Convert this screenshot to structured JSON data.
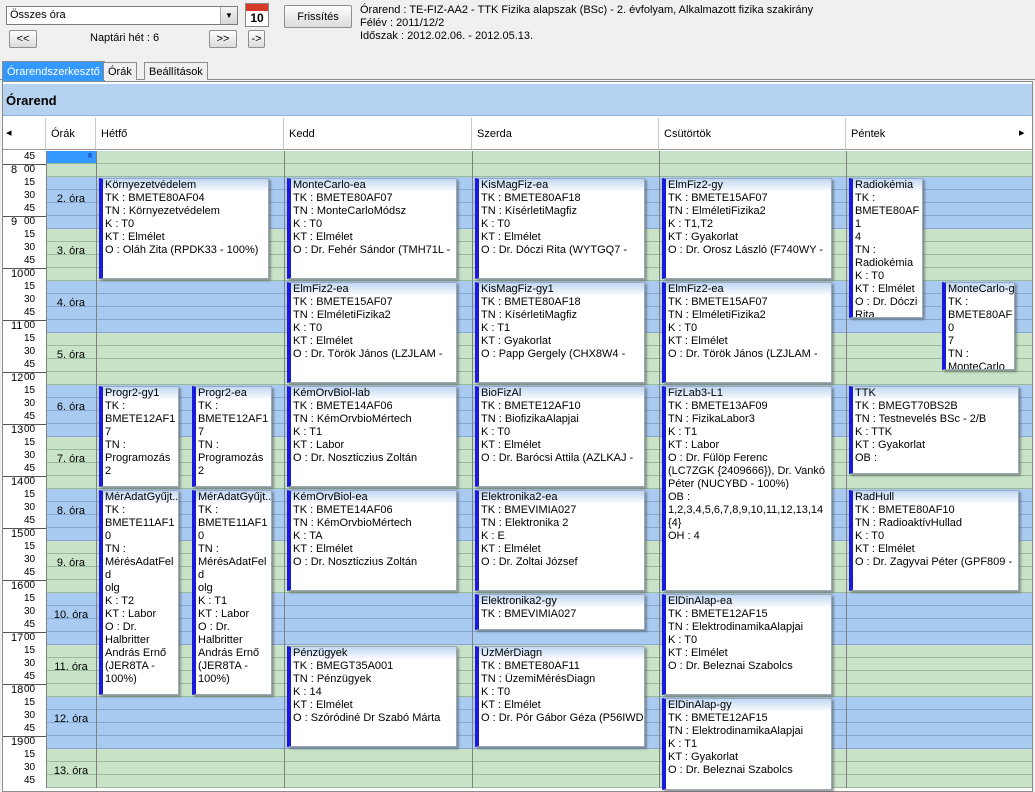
{
  "toolbar": {
    "select_value": "Összes óra",
    "refresh_label": "Frissítés",
    "calendar_icon_text": "10",
    "prev_label": "<<",
    "next_label": ">>",
    "end_label": "->",
    "week_label": "Naptári hét : 6"
  },
  "info": {
    "line1": "Órarend : TE-FIZ-AA2 - TTK Fizika alapszak (BSc) - 2. évfolyam, Alkalmazott fizika szakirány",
    "line2": "Félév : 2011/12/2",
    "line3": "Időszak : 2012.02.06. - 2012.05.13."
  },
  "tabs": [
    "Órarendszerkesztő",
    "Órák",
    "Beállítások"
  ],
  "panel_title": "Órarend",
  "columns": {
    "orak": "Órák",
    "days": [
      "Hétfő",
      "Kedd",
      "Szerda",
      "Csütörtök",
      "Péntek"
    ]
  },
  "scroll": {
    "left": "◂",
    "right": "▸",
    "up": "»"
  },
  "time": {
    "hours": [
      "8",
      "9",
      "10",
      "11",
      "12",
      "13",
      "14",
      "15",
      "16",
      "17",
      "18",
      "19"
    ],
    "hour_minute": "00",
    "minutes": [
      "15",
      "30",
      "45"
    ],
    "top_min": "45"
  },
  "lessons": [
    "2. óra",
    "3. óra",
    "4. óra",
    "5. óra",
    "6. óra",
    "7. óra",
    "8. óra",
    "9. óra",
    "10. óra",
    "11. óra",
    "12. óra",
    "13. óra"
  ],
  "events": [
    {
      "title": "Környezetvédelem",
      "lines": [
        "TK : BMETE80AF04",
        "TN : Környezetvédelem",
        "K : T0",
        "KT : Elmélet",
        "O : Oláh Zita (RPDK33 - 100%)"
      ]
    },
    {
      "title": "MonteCarlo-ea",
      "lines": [
        "TK : BMETE80AF07",
        "TN : MonteCarloMódsz",
        "K : T0",
        "KT : Elmélet",
        "O : Dr. Fehér Sándor (TMH71L -"
      ]
    },
    {
      "title": "KisMagFiz-ea",
      "lines": [
        "TK : BMETE80AF18",
        "TN : KísérletiMagfiz",
        "K : T0",
        "KT : Elmélet",
        "O : Dr. Dóczi Rita (WYTGQ7 -"
      ]
    },
    {
      "title": "ElmFiz2-gy",
      "lines": [
        "TK : BMETE15AF07",
        "TN : ElméletiFizika2",
        "K : T1,T2",
        "KT : Gyakorlat",
        "O : Dr. Orosz László (F740WY -"
      ]
    },
    {
      "title": "Radiokémia",
      "lines": [
        "TK :",
        "BMETE80AF1",
        "4",
        "TN :",
        "Radiokémia",
        "K : T0",
        "KT : Elmélet",
        "O : Dr. Dóczi",
        "Rita"
      ]
    },
    {
      "title": "ElmFiz2-ea",
      "lines": [
        "TK : BMETE15AF07",
        "TN : ElméletiFizika2",
        "K : T0",
        "KT : Elmélet",
        "O : Dr. Török János (LZJLAM -"
      ]
    },
    {
      "title": "KisMagFiz-gy1",
      "lines": [
        "TK : BMETE80AF18",
        "TN : KísérletiMagfiz",
        "K : T1",
        "KT : Gyakorlat",
        "O : Papp Gergely (CHX8W4 -"
      ]
    },
    {
      "title": "ElmFiz2-ea",
      "lines": [
        "TK : BMETE15AF07",
        "TN : ElméletiFizika2",
        "K : T0",
        "KT : Elmélet",
        "O : Dr. Török János (LZJLAM -"
      ]
    },
    {
      "title": "MonteCarlo-gy",
      "lines": [
        "TK :",
        "BMETE80AF0",
        "7",
        "TN :",
        "MonteCarloMó"
      ]
    },
    {
      "title": "Progr2-gy1",
      "lines": [
        "TK :",
        "BMETE12AF1",
        "7",
        "TN :",
        "Programozás 2"
      ]
    },
    {
      "title": "Progr2-ea",
      "lines": [
        "TK :",
        "BMETE12AF1",
        "7",
        "TN :",
        "Programozás 2"
      ]
    },
    {
      "title": "KémOrvBiol-lab",
      "lines": [
        "TK : BMETE14AF06",
        "TN : KémOrvbioMértech",
        "K : T1",
        "KT : Labor",
        "O : Dr. Noszticzius Zoltán"
      ]
    },
    {
      "title": "BioFizAl",
      "lines": [
        "TK : BMETE12AF10",
        "TN : BiofizikaAlapjai",
        "K : T0",
        "KT : Elmélet",
        "O : Dr. Barócsi Attila (AZLKAJ -"
      ]
    },
    {
      "title": "FizLab3-L1",
      "lines": [
        "TK : BMETE13AF09",
        "TN : FizikaLabor3",
        "K : T1",
        "KT : Labor",
        "O : Dr. Fülöp Ferenc",
        "(LC7ZGK {2409666}), Dr. Vankó",
        "Péter (NUCYBD - 100%)",
        "OB :",
        "1,2,3,4,5,6,7,8,9,10,11,12,13,14",
        "{4}",
        "OH : 4"
      ]
    },
    {
      "title": "TTK",
      "lines": [
        "TK : BMEGT70BS2B",
        "TN : Testnevelés BSc - 2/B",
        "K : TTK",
        "KT : Gyakorlat",
        "OB :"
      ]
    },
    {
      "title": "MérAdatGyűjt...",
      "lines": [
        "TK :",
        "BMETE11AF1",
        "0",
        "TN :",
        "MérésAdatFeld",
        "olg",
        "K : T2",
        "KT : Labor",
        "O : Dr.",
        "Halbritter",
        "András Ernő",
        "(JER8TA -",
        "100%)"
      ]
    },
    {
      "title": "MérAdatGyűjt...",
      "lines": [
        "TK :",
        "BMETE11AF1",
        "0",
        "TN :",
        "MérésAdatFeld",
        "olg",
        "K : T1",
        "KT : Labor",
        "O : Dr.",
        "Halbritter",
        "András Ernő",
        "(JER8TA -",
        "100%)"
      ]
    },
    {
      "title": "KémOrvBiol-ea",
      "lines": [
        "TK : BMETE14AF06",
        "TN : KémOrvbioMértech",
        "K : TA",
        "KT : Elmélet",
        "O : Dr. Noszticzius Zoltán"
      ]
    },
    {
      "title": "Elektronika2-ea",
      "lines": [
        "TK : BMEVIMIA027",
        "TN : Elektronika 2",
        "K : E",
        "KT : Elmélet",
        "O : Dr. Zoltai József"
      ]
    },
    {
      "title": "RadHull",
      "lines": [
        "TK : BMETE80AF10",
        "TN : RadioaktívHullad",
        "K : T0",
        "KT : Elmélet",
        "O : Dr. Zagyvai Péter (GPF809 -"
      ]
    },
    {
      "title": "Elektronika2-gy",
      "lines": [
        "TK : BMEVIMIA027"
      ]
    },
    {
      "title": "ElDinAlap-ea",
      "lines": [
        "TK : BMETE12AF15",
        "TN : ElektrodinamikaAlapjai",
        "K : T0",
        "KT : Elmélet",
        "O : Dr. Beleznai Szabolcs"
      ]
    },
    {
      "title": "Pénzügyek",
      "lines": [
        "TK : BMEGT35A001",
        "TN : Pénzügyek",
        "K : 14",
        "KT : Elmélet",
        "O : Szóródiné Dr Szabó Márta"
      ]
    },
    {
      "title": "ÜzMérDiagn",
      "lines": [
        "TK : BMETE80AF11",
        "TN : ÜzemiMérésDiagn",
        "K : T0",
        "KT : Elmélet",
        "O : Dr. Pór Gábor Géza (P56IWD"
      ]
    },
    {
      "title": "ElDinAlap-gy",
      "lines": [
        "TK : BMETE12AF15",
        "TN : ElektrodinamikaAlapjai",
        "K : T1",
        "KT : Gyakorlat",
        "O : Dr. Beleznai Szabolcs"
      ]
    }
  ]
}
